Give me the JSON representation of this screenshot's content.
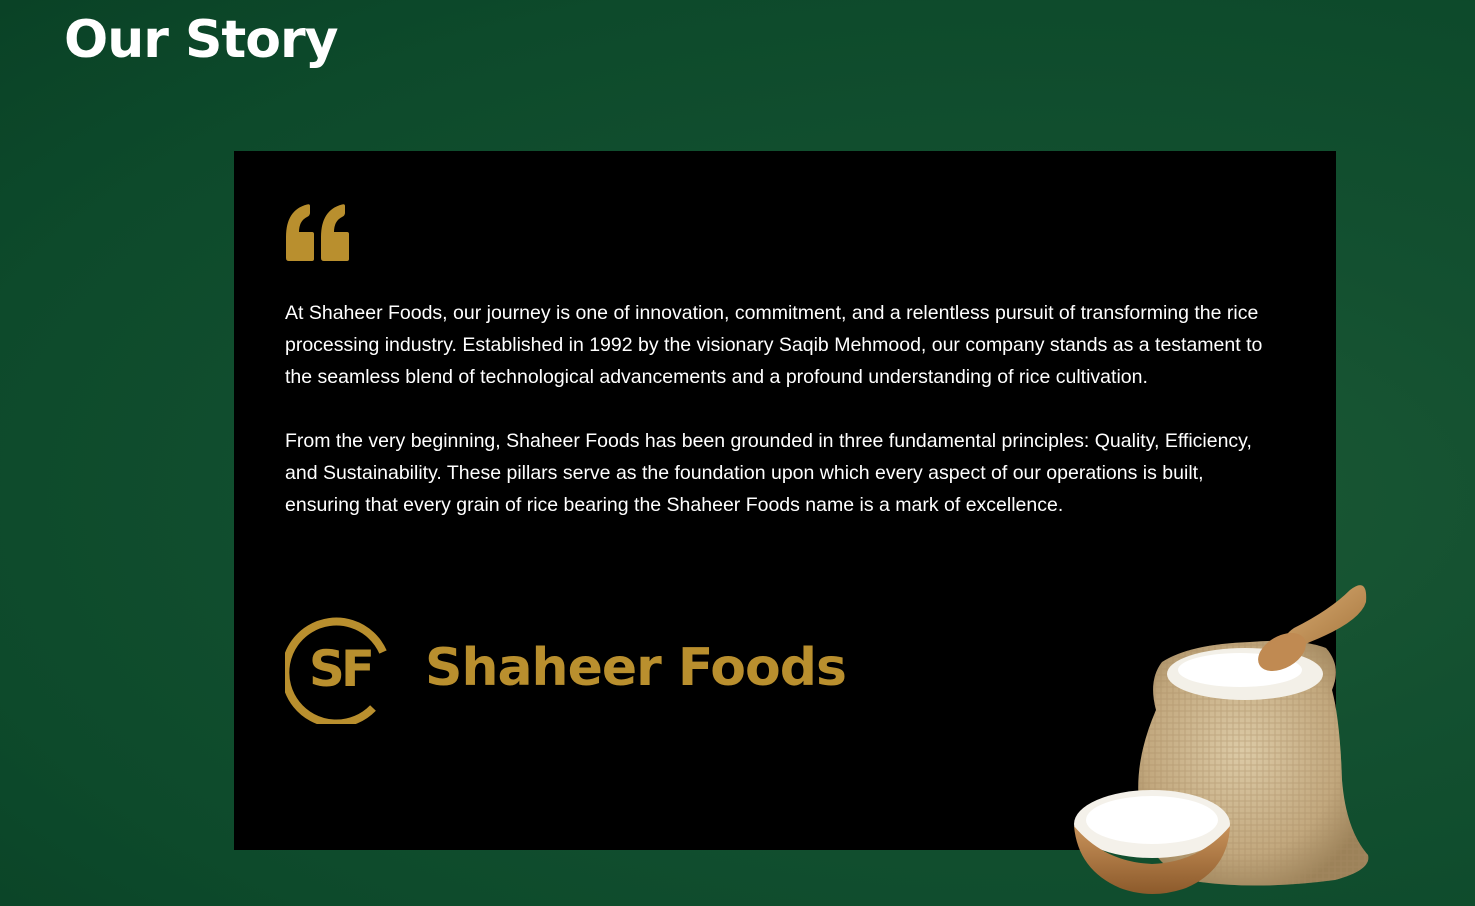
{
  "header": {
    "title": "Our Story"
  },
  "story": {
    "paragraphs": [
      "At Shaheer Foods, our journey is one of innovation, commitment, and a relentless pursuit of transforming the rice processing industry. Established in 1992 by the visionary Saqib Mehmood, our company stands as a testament to the seamless blend of technological advancements and a profound understanding of rice cultivation.",
      "From the very beginning, Shaheer Foods has been grounded in three fundamental principles: Quality, Efficiency, and Sustainability. These pillars serve as the foundation upon which every aspect of our operations is built, ensuring that every grain of rice bearing the Shaheer Foods name is a mark of excellence."
    ]
  },
  "brand": {
    "name": "Shaheer Foods",
    "monogram": "SF"
  },
  "icons": {
    "quote": "quote-icon",
    "logo": "shaheer-foods-logo-icon",
    "illustration": "rice-sack-illustration"
  },
  "colors": {
    "background": "#0d4a2b",
    "card": "#000000",
    "accent_gold": "#b98f2e",
    "text": "#ffffff"
  }
}
